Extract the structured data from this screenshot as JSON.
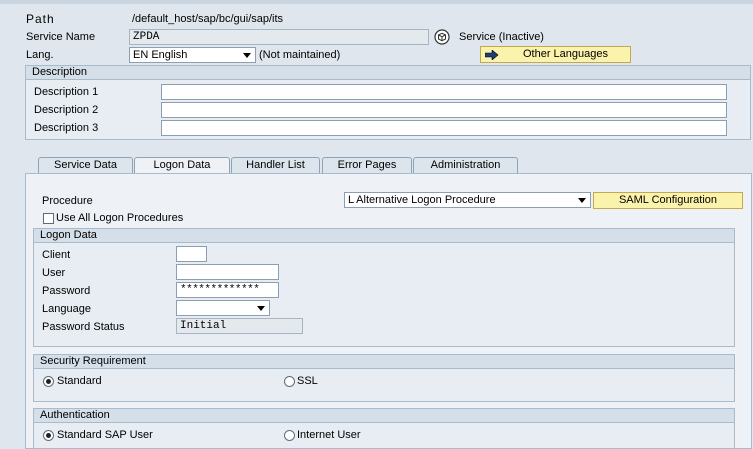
{
  "header": {
    "path_label": "Path",
    "path_value": "/default_host/sap/bc/gui/sap/its",
    "service_name_label": "Service Name",
    "service_name_value": "ZPDA",
    "service_status": "Service (Inactive)",
    "lang_label": "Lang.",
    "lang_value": "EN English",
    "lang_status": "(Not maintained)",
    "other_languages_button": "Other Languages"
  },
  "description": {
    "title": "Description",
    "rows": [
      {
        "label": "Description 1",
        "value": ""
      },
      {
        "label": "Description 2",
        "value": ""
      },
      {
        "label": "Description 3",
        "value": ""
      }
    ]
  },
  "tabs": [
    {
      "label": "Service Data",
      "active": false
    },
    {
      "label": "Logon Data",
      "active": true
    },
    {
      "label": "Handler List",
      "active": false
    },
    {
      "label": "Error Pages",
      "active": false
    },
    {
      "label": "Administration",
      "active": false
    }
  ],
  "procedure": {
    "label": "Procedure",
    "value": "L Alternative Logon Procedure",
    "saml_button": "SAML Configuration",
    "use_all_label": "Use All Logon Procedures",
    "use_all_checked": false
  },
  "logon_data": {
    "title": "Logon Data",
    "client_label": "Client",
    "client_value": "",
    "user_label": "User",
    "user_value": "",
    "password_label": "Password",
    "password_value": "*************",
    "language_label": "Language",
    "language_value": "",
    "password_status_label": "Password Status",
    "password_status_value": "Initial"
  },
  "security": {
    "title": "Security Requirement",
    "option_standard": "Standard",
    "option_ssl": "SSL",
    "selected": "standard"
  },
  "authentication": {
    "title": "Authentication",
    "option_standard_sap_user": "Standard SAP User",
    "option_internet_user": "Internet User",
    "selected": "standard_sap_user"
  },
  "colors": {
    "background": "#dfe6ed",
    "button_yellow": "#fbf2ab",
    "group_header": "#d4dfe9"
  },
  "icons": {
    "service_icon": "cube-icon",
    "other_languages_icon": "arrow-right-icon"
  }
}
